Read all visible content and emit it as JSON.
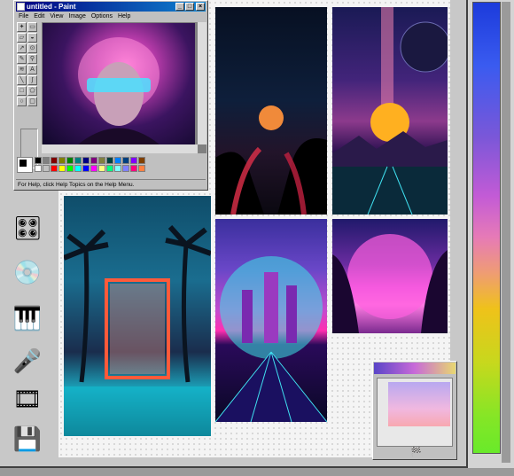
{
  "paint": {
    "title": "untitled - Paint",
    "menus": [
      "File",
      "Edit",
      "View",
      "Image",
      "Options",
      "Help"
    ],
    "status": "For Help, click Help Topics on the Help Menu.",
    "palette": [
      "#000000",
      "#808080",
      "#800000",
      "#808000",
      "#008000",
      "#008080",
      "#000080",
      "#800080",
      "#808040",
      "#004040",
      "#0080ff",
      "#004080",
      "#8000ff",
      "#804000",
      "#ffffff",
      "#c0c0c0",
      "#ff0000",
      "#ffff00",
      "#00ff00",
      "#00ffff",
      "#0000ff",
      "#ff00ff",
      "#ffff80",
      "#00ff80",
      "#80ffff",
      "#8080ff",
      "#ff0080",
      "#ff8040"
    ]
  },
  "sidebar": {
    "icons": [
      "cd-player-icon",
      "music-cd-icon",
      "keyboard-icon",
      "microphone-icon",
      "windows-media-icon",
      "disk-icon"
    ]
  },
  "colors": {
    "desktop": "#f4f4f4",
    "titlebar": "#000080",
    "gradient_top": "#1c3bdb",
    "gradient_bottom": "#69ea2a"
  }
}
